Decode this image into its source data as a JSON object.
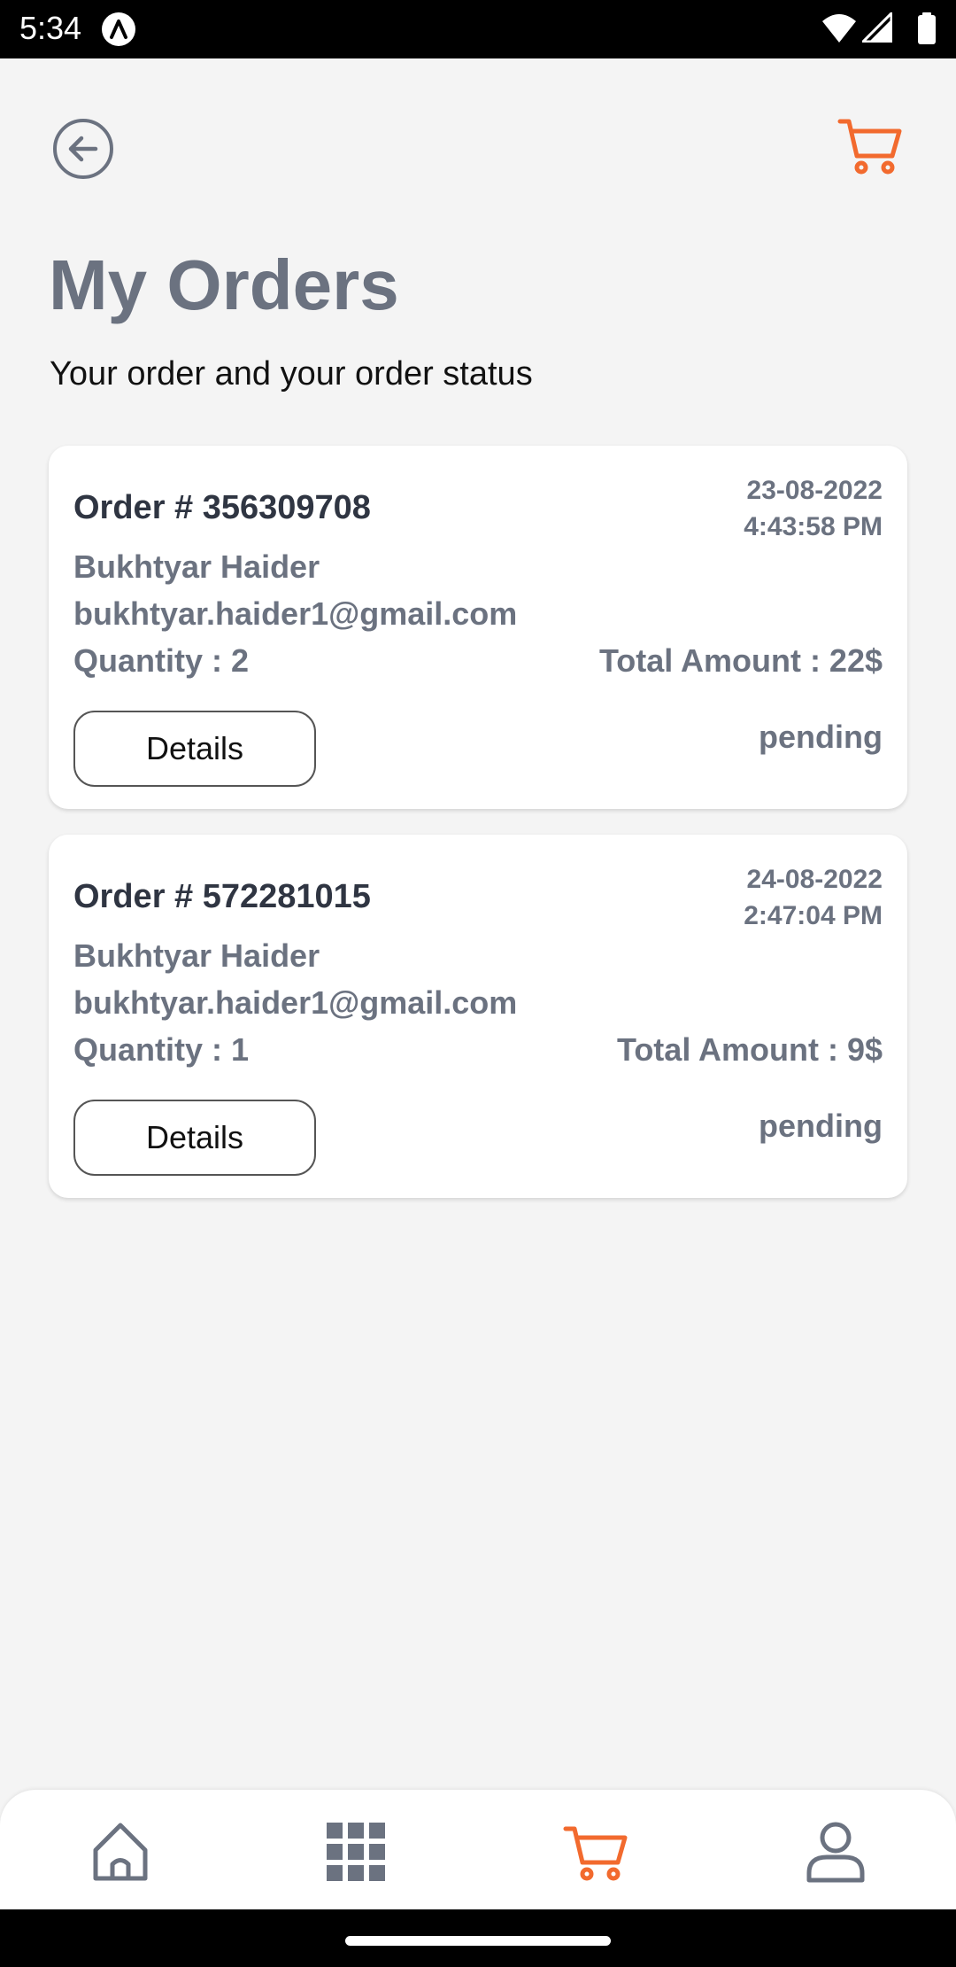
{
  "status_bar": {
    "time": "5:34",
    "icons": [
      "app-notification-icon",
      "wifi-icon",
      "signal-icon",
      "battery-icon"
    ]
  },
  "header": {
    "back_icon": "back-arrow-circle-icon",
    "cart_icon": "cart-icon"
  },
  "page": {
    "title": "My Orders",
    "subtitle": "Your order and your order status"
  },
  "orders": [
    {
      "number": "Order # 356309708",
      "date": "23-08-2022",
      "time": "4:43:58 PM",
      "name": "Bukhtyar Haider",
      "email": "bukhtyar.haider1@gmail.com",
      "quantity": "Quantity : 2",
      "total": "Total Amount : 22$",
      "details_label": "Details",
      "status": "pending"
    },
    {
      "number": "Order # 572281015",
      "date": "24-08-2022",
      "time": "2:47:04 PM",
      "name": "Bukhtyar Haider",
      "email": "bukhtyar.haider1@gmail.com",
      "quantity": "Quantity : 1",
      "total": "Total Amount : 9$",
      "details_label": "Details",
      "status": "pending"
    }
  ],
  "bottom_nav": {
    "items": [
      {
        "icon": "home-icon",
        "active": false
      },
      {
        "icon": "grid-icon",
        "active": false
      },
      {
        "icon": "cart-icon",
        "active": true
      },
      {
        "icon": "profile-icon",
        "active": false
      }
    ]
  },
  "colors": {
    "accent": "#f26a2e",
    "text_muted": "#6b7280",
    "text_dark": "#2f3542",
    "background": "#f4f4f4"
  }
}
